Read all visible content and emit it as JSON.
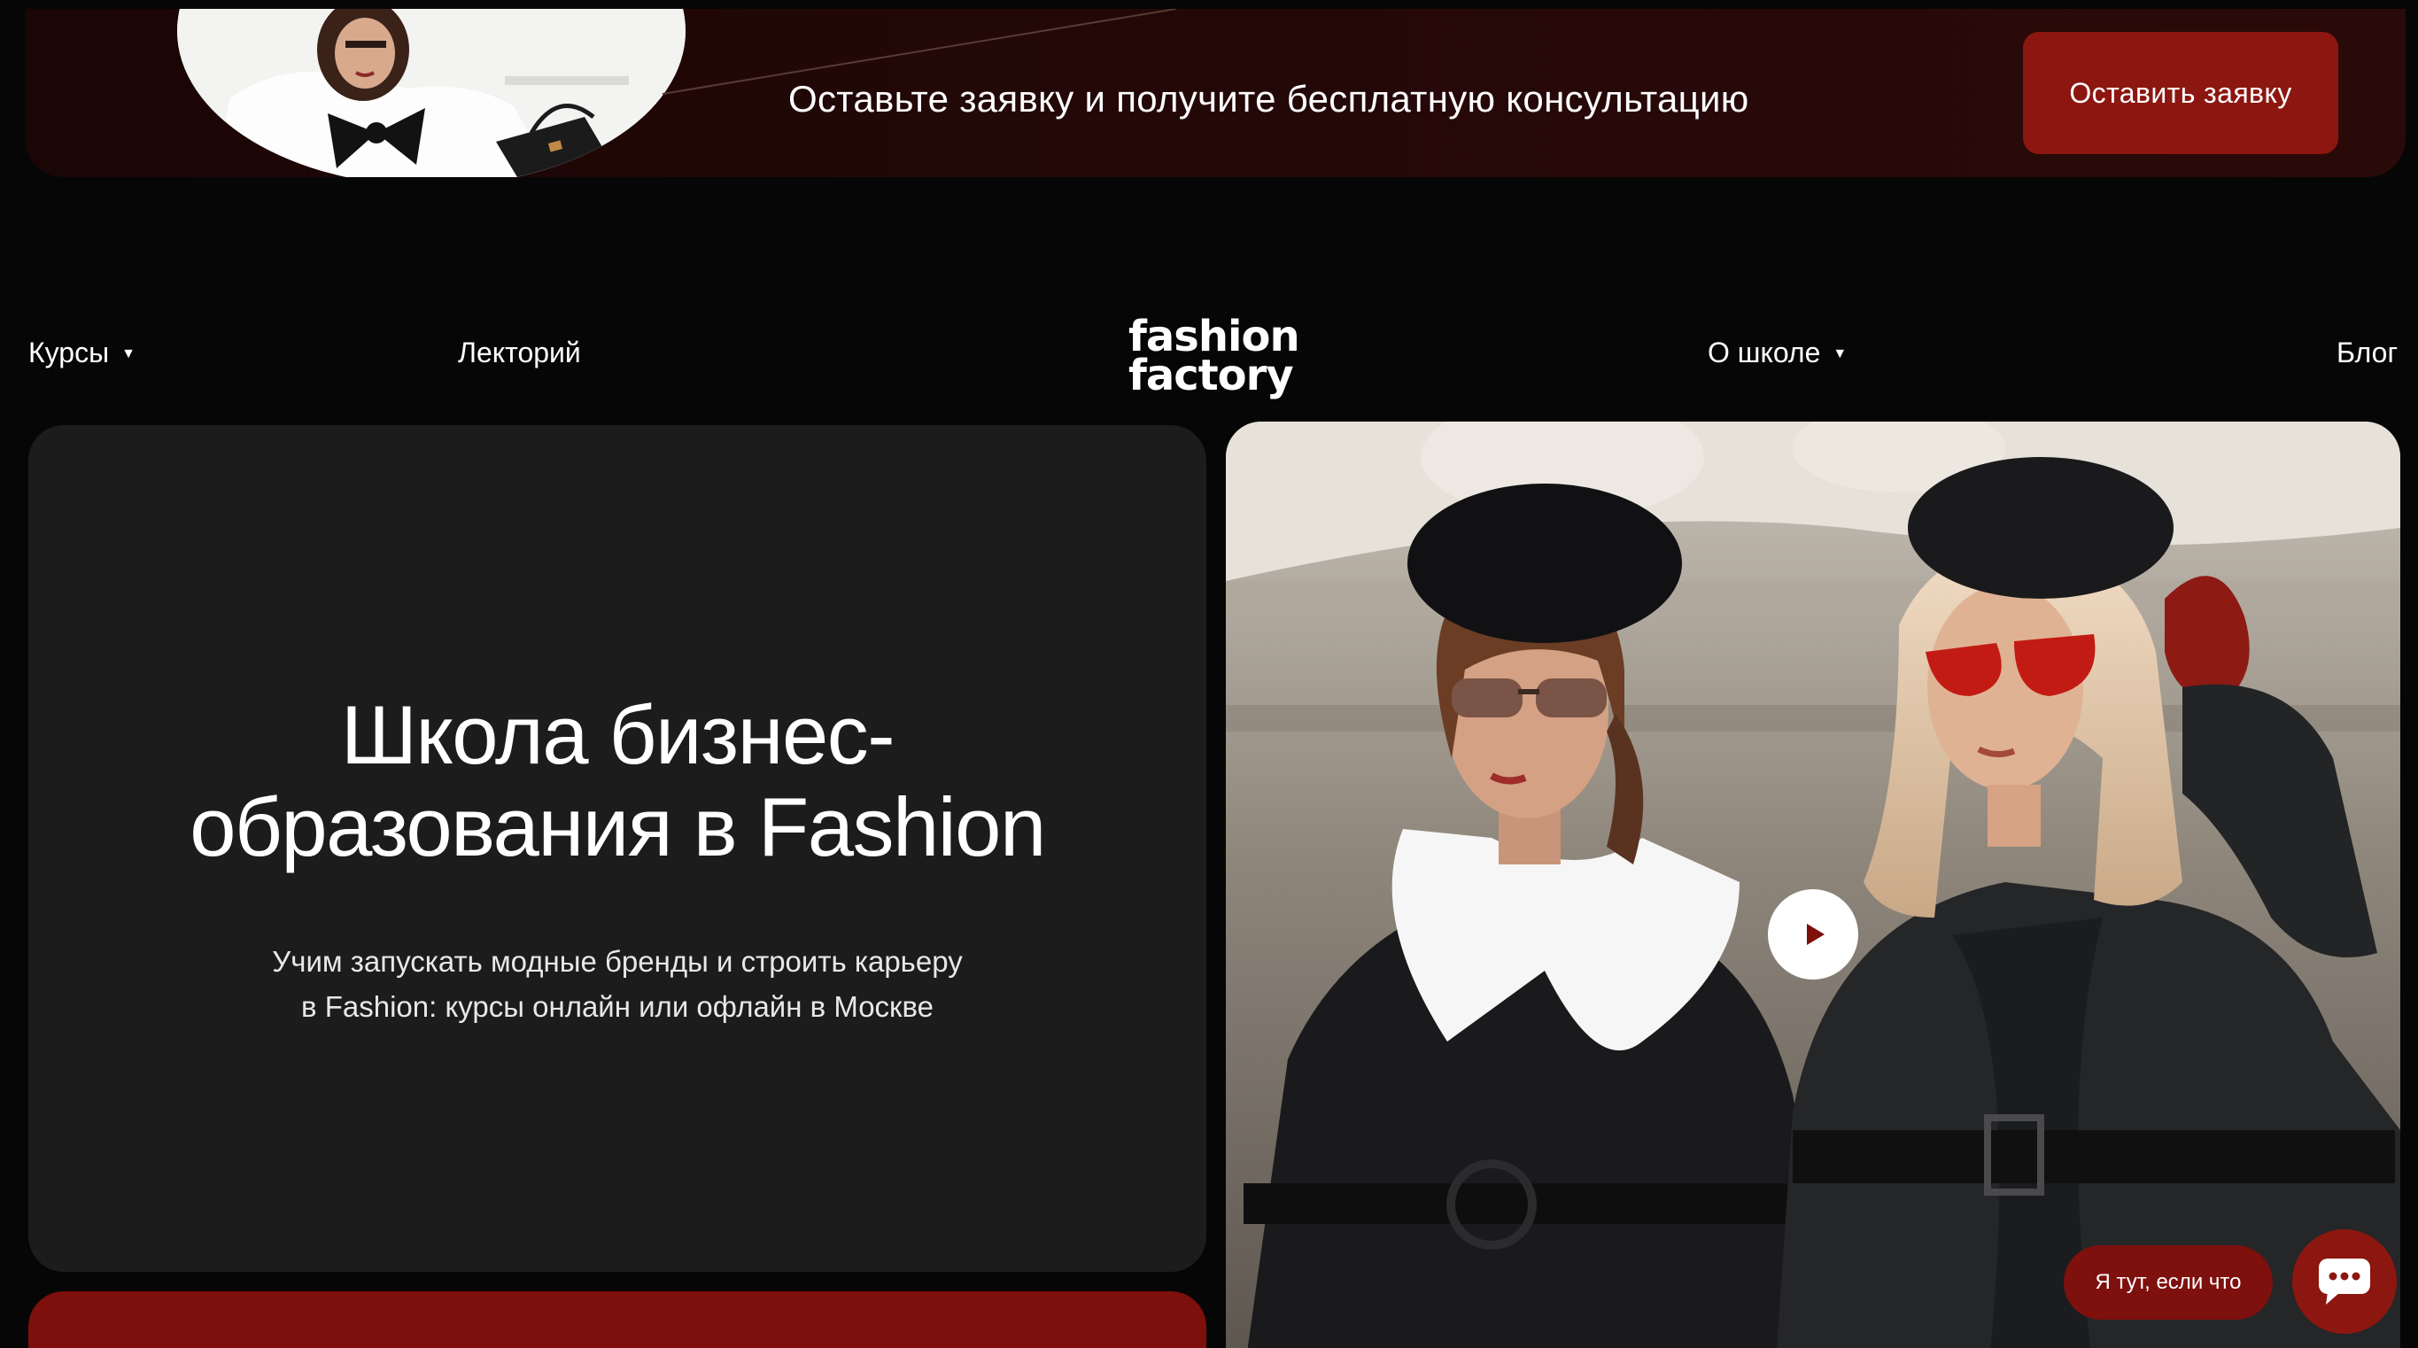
{
  "promo": {
    "text": "Оставьте заявку и получите бесплатную консультацию",
    "button_label": "Оставить заявку"
  },
  "nav": {
    "courses": "Курсы",
    "lectures": "Лекторий",
    "about": "О школе",
    "blog": "Блог",
    "logo_line1": "fashion",
    "logo_line2": "factory"
  },
  "hero": {
    "title_line1": "Школа бизнес-",
    "title_line2": "образования в Fashion",
    "subtitle_line1": "Учим запускать модные бренды и строить карьеру",
    "subtitle_line2": "в Fashion: курсы онлайн или офлайн в Москве"
  },
  "chat": {
    "bubble_text": "Я тут, если что"
  },
  "icons": {
    "courses_dropdown": "chevron-down-icon",
    "about_dropdown": "chevron-down-icon",
    "play": "play-icon",
    "chat": "chat-icon"
  },
  "colors": {
    "background": "#060606",
    "card": "#1d1c1d",
    "accent_red": "#8c1710",
    "dark_red": "#7d0f0d"
  }
}
